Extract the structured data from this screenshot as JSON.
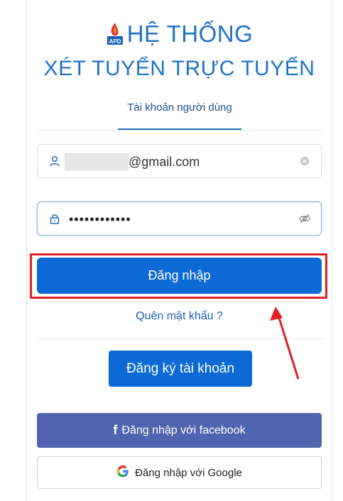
{
  "brand": {
    "title_line1": "HỆ THỐNG",
    "title_line2": "XÉT TUYỂN TRỰC TUYẾN",
    "logo_text": "APD",
    "color": "#1f73c5"
  },
  "tabs": [
    {
      "label": "Tài khoản người dùng",
      "active": true
    }
  ],
  "form": {
    "email_value": "@gmail.com",
    "password_value": "••••••••••••",
    "login_label": "Đăng nhập",
    "forgot_label": "Quên mật khẩu ?",
    "register_label": "Đăng ký tài khoản",
    "facebook_label": "Đăng nhập với facebook",
    "google_label": "Đăng nhập với Google"
  },
  "icons": {
    "email_lead": "user-icon",
    "email_trail": "clear-icon",
    "password_lead": "lock-icon",
    "password_trail": "eye-off-icon",
    "facebook": "facebook-icon",
    "google": "google-icon"
  },
  "colors": {
    "primary": "#0d6ad4",
    "facebook": "#5164b0",
    "highlight": "#e01f26"
  }
}
